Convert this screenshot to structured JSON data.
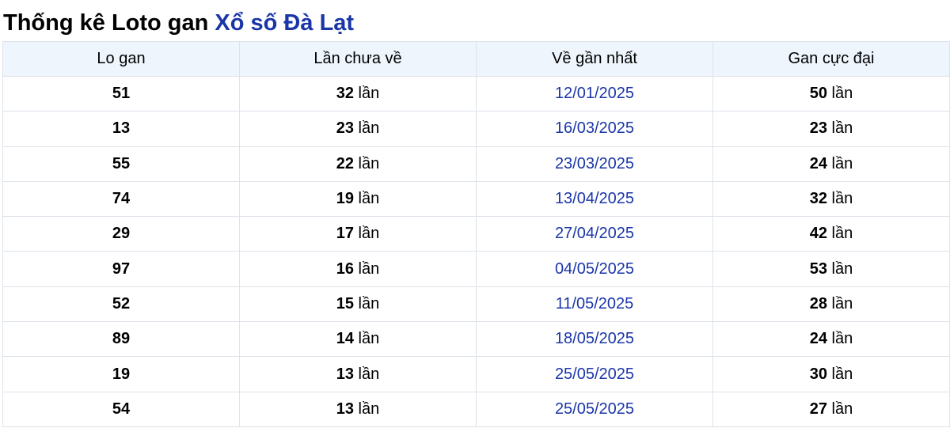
{
  "page": {
    "title_main": "Thống kê Loto gan",
    "title_brand": "Xổ số Đà Lạt",
    "brand_color": "#1a35a8",
    "header_bg_color": "#eef5fc"
  },
  "table": {
    "headers": [
      "Lo gan",
      "Lần chưa về",
      "Về gần nhất",
      "Gan cực đại"
    ],
    "unit": "lần",
    "rows": [
      {
        "lo": "51",
        "chua_ve": "32",
        "gan_nhat": "12/01/2025",
        "cuc_dai": "50"
      },
      {
        "lo": "13",
        "chua_ve": "23",
        "gan_nhat": "16/03/2025",
        "cuc_dai": "23"
      },
      {
        "lo": "55",
        "chua_ve": "22",
        "gan_nhat": "23/03/2025",
        "cuc_dai": "24"
      },
      {
        "lo": "74",
        "chua_ve": "19",
        "gan_nhat": "13/04/2025",
        "cuc_dai": "32"
      },
      {
        "lo": "29",
        "chua_ve": "17",
        "gan_nhat": "27/04/2025",
        "cuc_dai": "42"
      },
      {
        "lo": "97",
        "chua_ve": "16",
        "gan_nhat": "04/05/2025",
        "cuc_dai": "53"
      },
      {
        "lo": "52",
        "chua_ve": "15",
        "gan_nhat": "11/05/2025",
        "cuc_dai": "28"
      },
      {
        "lo": "89",
        "chua_ve": "14",
        "gan_nhat": "18/05/2025",
        "cuc_dai": "24"
      },
      {
        "lo": "19",
        "chua_ve": "13",
        "gan_nhat": "25/05/2025",
        "cuc_dai": "30"
      },
      {
        "lo": "54",
        "chua_ve": "13",
        "gan_nhat": "25/05/2025",
        "cuc_dai": "27"
      }
    ]
  }
}
